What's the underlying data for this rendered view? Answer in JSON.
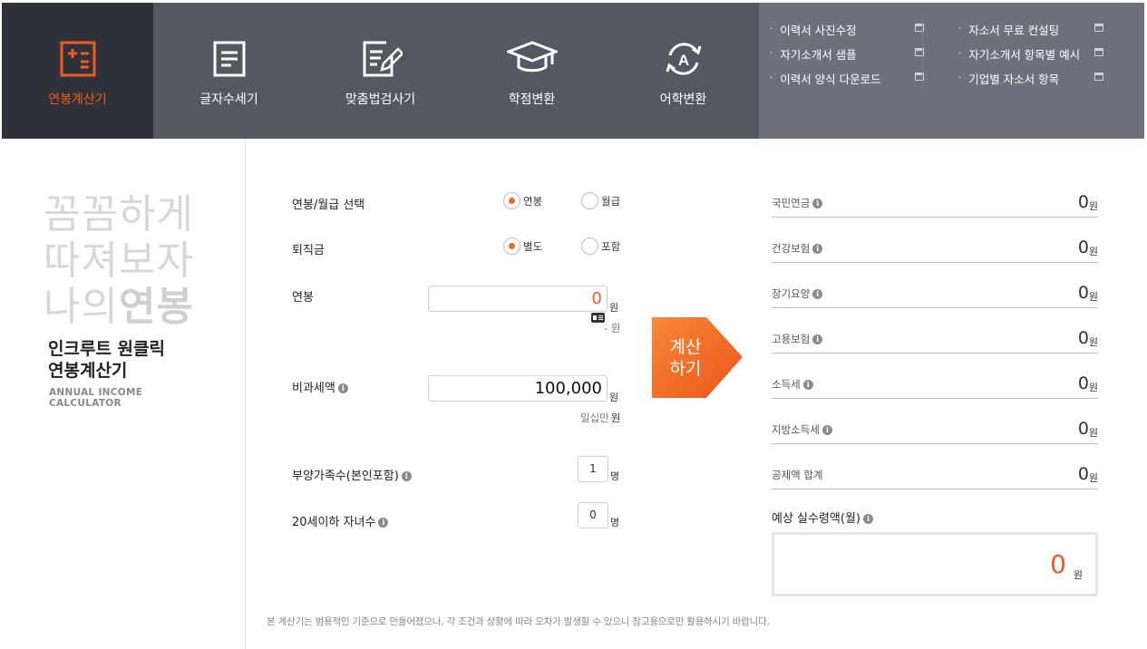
{
  "nav": {
    "tools": [
      {
        "label": "연봉계산기",
        "icon": "salary-calculator-icon",
        "active": true
      },
      {
        "label": "글자수세기",
        "icon": "character-count-icon",
        "active": false
      },
      {
        "label": "맞춤법검사기",
        "icon": "spell-check-icon",
        "active": false
      },
      {
        "label": "학점변환",
        "icon": "graduation-cap-icon",
        "active": false
      },
      {
        "label": "어학변환",
        "icon": "language-convert-icon",
        "active": false
      }
    ],
    "quicklinks_left": [
      "이력서 사진수정",
      "자기소개서 샘플",
      "이력서 양식 다운로드"
    ],
    "quicklinks_right": [
      "자소서 무료 컨설팅",
      "자기소개서 항목별 예시",
      "기업별 자소서 항목"
    ],
    "bullet": "·"
  },
  "brand": {
    "slogan_line1": "꼼꼼하게",
    "slogan_line2": "따져보자",
    "slogan_line3_a": "나의",
    "slogan_line3_b": "연봉",
    "title_line1": "인크루트 원클릭",
    "title_line2": "연봉계산기",
    "sub_line1": "ANNUAL INCOME",
    "sub_line2": "CALCULATOR"
  },
  "form": {
    "pay_type_label": "연봉/월급 선택",
    "pay_type_options": [
      "연봉",
      "월급"
    ],
    "pay_type_selected": "연봉",
    "severance_label": "퇴직금",
    "severance_options": [
      "별도",
      "포함"
    ],
    "severance_selected": "별도",
    "salary_label": "연봉",
    "salary_value": "0",
    "salary_unit": "원",
    "salary_korean": "- 원",
    "nontax_label": "비과세액",
    "nontax_value": "100,000",
    "nontax_unit": "원",
    "nontax_korean": "일십만",
    "nontax_korean_unit": "원",
    "dependents_label": "부양가족수(본인포함)",
    "dependents_value": "1",
    "dependents_unit": "명",
    "children_label": "20세이하 자녀수",
    "children_value": "0",
    "children_unit": "명",
    "info_glyph": "i"
  },
  "calc_button": {
    "line1": "계산",
    "line2": "하기",
    "color": "#ee5a24"
  },
  "results": [
    {
      "name": "국민연금",
      "value": "0",
      "info": true
    },
    {
      "name": "건강보험",
      "value": "0",
      "info": true
    },
    {
      "name": "장기요양",
      "value": "0",
      "info": true
    },
    {
      "name": "고용보험",
      "value": "0",
      "info": true
    },
    {
      "name": "소득세",
      "value": "0",
      "info": true
    },
    {
      "name": "지방소득세",
      "value": "0",
      "info": true
    },
    {
      "name": "공제액 합계",
      "value": "0",
      "info": false
    }
  ],
  "won": "원",
  "expected": {
    "label": "예상 실수령액(월)",
    "value": "0",
    "unit": "원"
  },
  "disclaimer": "본 계산기는 범용적인 기준으로 만들어졌으나, 각 조건과 상황에 따라 오차가 발생할 수 있으니 참고용으로만 활용하시기 바랍니다.",
  "colors": {
    "accent": "#ee5a24",
    "nav_dark": "#2f3238",
    "nav_mid": "#535861",
    "nav_light": "#6c717b"
  }
}
